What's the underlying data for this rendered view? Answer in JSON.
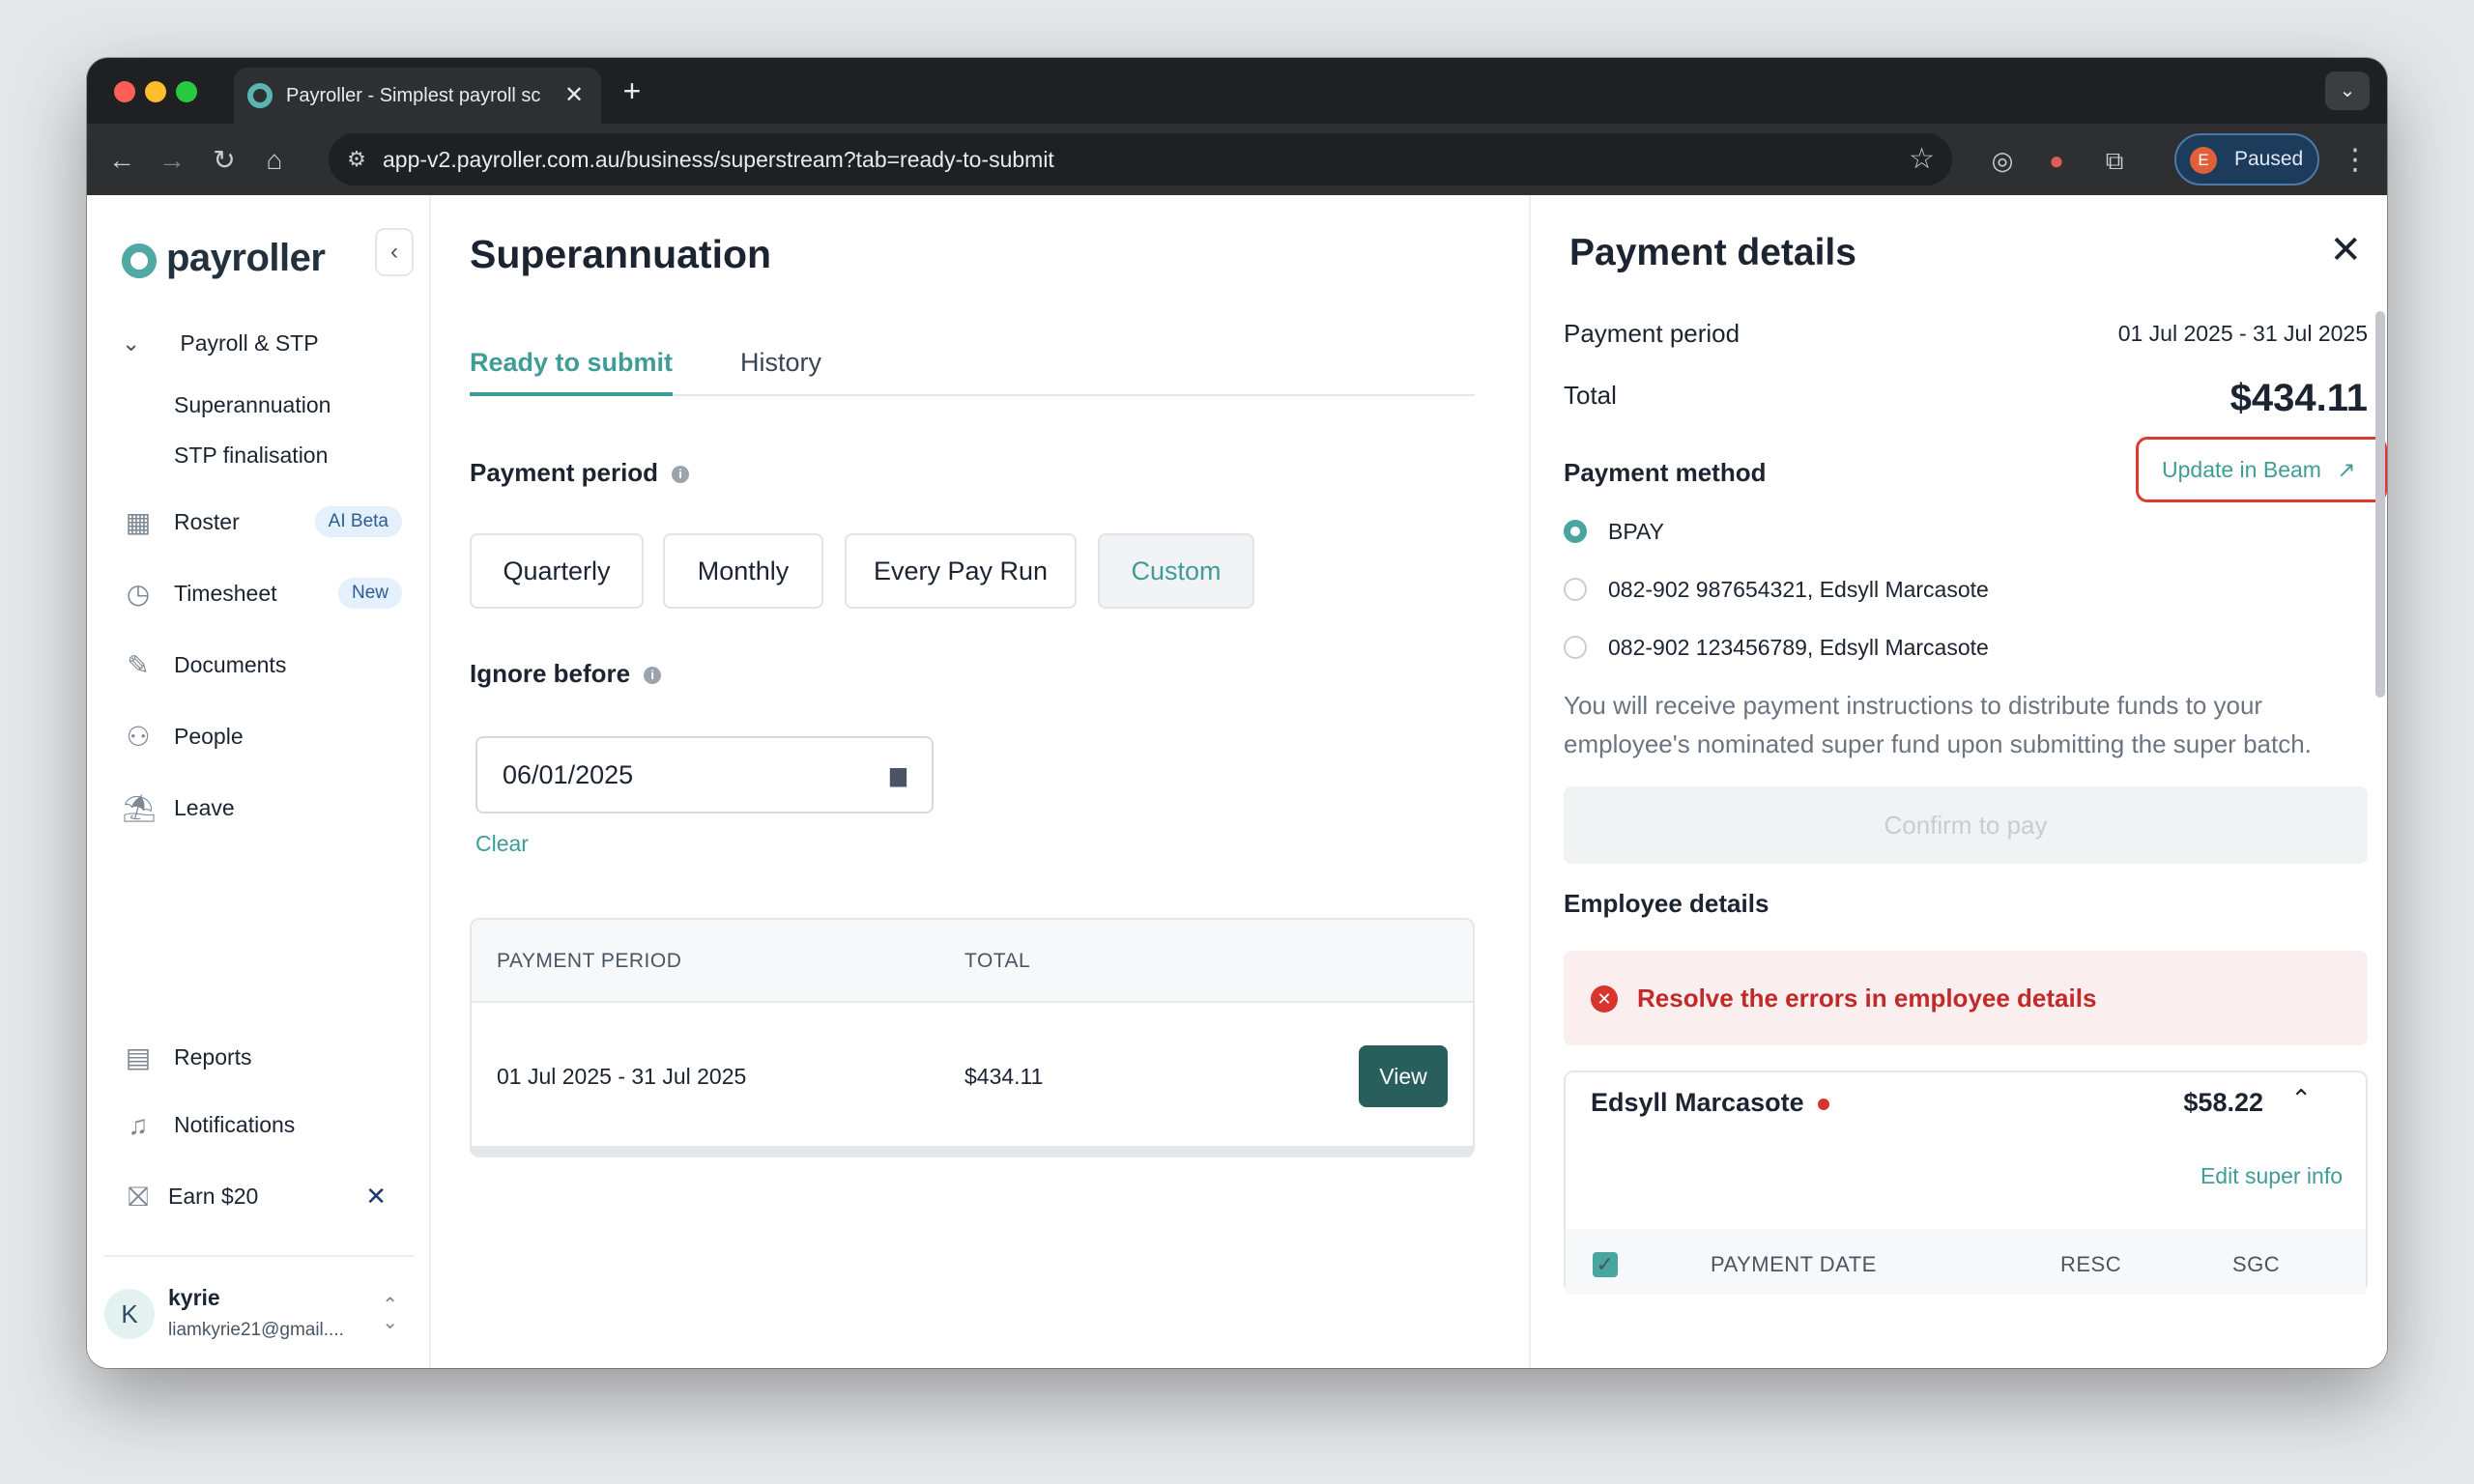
{
  "browser": {
    "tab_title": "Payroller - Simplest payroll sc",
    "url": "app-v2.payroller.com.au/business/superstream?tab=ready-to-submit",
    "profile_initial": "E",
    "profile_label": "Paused",
    "traffic_colors": [
      "#ff5f57",
      "#febc2e",
      "#28c840"
    ]
  },
  "sidebar": {
    "brand": "payroller",
    "section": "Payroll & STP",
    "subitems": [
      "Superannuation",
      "STP finalisation"
    ],
    "items": [
      {
        "label": "Roster",
        "badge": "AI Beta",
        "icon": "roster-icon"
      },
      {
        "label": "Timesheet",
        "badge": "New",
        "icon": "timesheet-icon"
      },
      {
        "label": "Documents",
        "icon": "documents-icon"
      },
      {
        "label": "People",
        "icon": "people-icon"
      },
      {
        "label": "Leave",
        "icon": "leave-icon"
      }
    ],
    "bottom": [
      {
        "label": "Reports",
        "icon": "reports-icon"
      },
      {
        "label": "Notifications",
        "icon": "bell-icon"
      },
      {
        "label": "Earn $20",
        "icon": "gift-icon"
      }
    ],
    "user": {
      "initial": "K",
      "name": "kyrie",
      "email": "liamkyrie21@gmail...."
    }
  },
  "main": {
    "title": "Superannuation",
    "tabs": [
      "Ready to submit",
      "History"
    ],
    "payment_period_label": "Payment period",
    "period_options": [
      "Quarterly",
      "Monthly",
      "Every Pay Run",
      "Custom"
    ],
    "selected_period": "Custom",
    "ignore_before_label": "Ignore before",
    "ignore_before_value": "06/01/2025",
    "clear_label": "Clear",
    "table": {
      "headers": [
        "PAYMENT PERIOD",
        "TOTAL"
      ],
      "rows": [
        {
          "period": "01 Jul 2025 - 31 Jul 2025",
          "total": "$434.11",
          "action": "View"
        }
      ]
    }
  },
  "panel": {
    "title": "Payment details",
    "period_label": "Payment period",
    "period_value": "01 Jul 2025 - 31 Jul 2025",
    "total_label": "Total",
    "total_value": "$434.11",
    "method_label": "Payment method",
    "update_label": "Update in Beam",
    "methods": [
      {
        "label": "BPAY",
        "selected": true
      },
      {
        "label": "082-902 987654321, Edsyll Marcasote",
        "selected": false
      },
      {
        "label": "082-902 123456789, Edsyll Marcasote",
        "selected": false
      }
    ],
    "note": "You will receive payment instructions to distribute funds to your employee's nominated super fund upon submitting the super batch.",
    "confirm_label": "Confirm to pay",
    "employee_details_label": "Employee details",
    "error_text": "Resolve the errors in employee details",
    "employee": {
      "name": "Edsyll Marcasote",
      "amount": "$58.22",
      "edit_label": "Edit super info",
      "columns": [
        "PAYMENT DATE",
        "RESC",
        "SGC"
      ]
    }
  },
  "colors": {
    "accent": "#3f9c96",
    "primary_button": "#285e5b",
    "error": "#d6342c",
    "highlight_border": "#e03a2c"
  }
}
